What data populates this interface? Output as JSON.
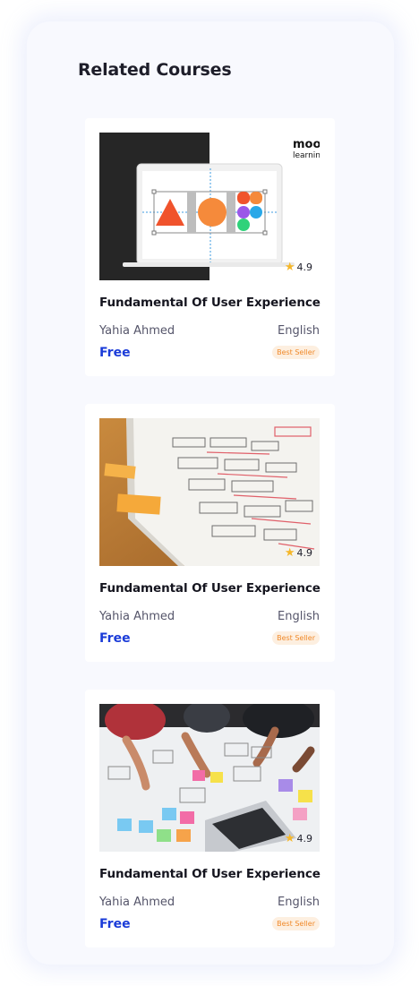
{
  "section": {
    "title": "Related Courses"
  },
  "courses": [
    {
      "thumbnail_icon": "design-tool-illustration",
      "logo_text": "moo",
      "logo_subtext": "learnin",
      "rating": "4.9",
      "title": "Fundamental Of User Experience",
      "instructor": "Yahia Ahmed",
      "language": "English",
      "price": "Free",
      "badge": "Best Seller"
    },
    {
      "thumbnail_icon": "wireframe-paper-photo",
      "rating": "4.9",
      "title": "Fundamental Of User Experience",
      "instructor": "Yahia Ahmed",
      "language": "English",
      "price": "Free",
      "badge": "Best Seller"
    },
    {
      "thumbnail_icon": "team-planning-photo",
      "rating": "4.9",
      "title": "Fundamental Of User Experience",
      "instructor": "Yahia Ahmed",
      "language": "English",
      "price": "Free",
      "badge": "Best Seller"
    }
  ],
  "colors": {
    "price": "#1a3bd8",
    "badge_bg": "#fdefe0",
    "badge_text": "#f08a2b",
    "star": "#f5b72a"
  }
}
